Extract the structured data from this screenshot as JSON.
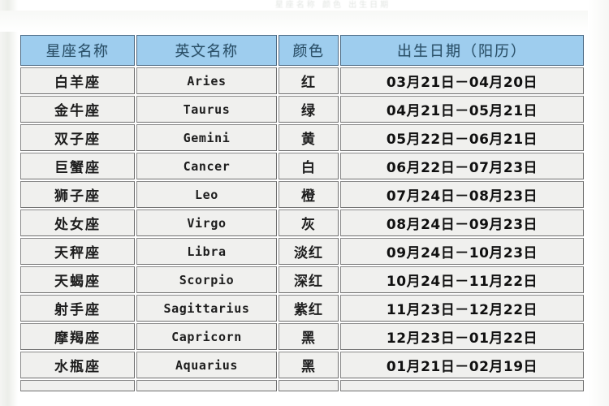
{
  "page": {
    "scan_remnant_text": "星座名称   颜色   出生日期",
    "background_color": "#ffffff"
  },
  "table": {
    "header_background": "#9ecdee",
    "header_text_color": "#2b4f66",
    "cell_background": "#f0f0ee",
    "border_color": "#6f6f6f",
    "columns": [
      {
        "key": "name",
        "label": "星座名称"
      },
      {
        "key": "en",
        "label": "英文名称"
      },
      {
        "key": "color",
        "label": "颜色"
      },
      {
        "key": "date",
        "label": "出生日期（阳历）"
      }
    ],
    "rows": [
      {
        "name": "白羊座",
        "en": "Aries",
        "color": "红",
        "date": "03月21日－04月20日"
      },
      {
        "name": "金牛座",
        "en": "Taurus",
        "color": "绿",
        "date": "04月21日－05月21日"
      },
      {
        "name": "双子座",
        "en": "Gemini",
        "color": "黄",
        "date": "05月22日－06月21日"
      },
      {
        "name": "巨蟹座",
        "en": "Cancer",
        "color": "白",
        "date": "06月22日－07月23日"
      },
      {
        "name": "狮子座",
        "en": "Leo",
        "color": "橙",
        "date": "07月24日－08月23日"
      },
      {
        "name": "处女座",
        "en": "Virgo",
        "color": "灰",
        "date": "08月24日－09月23日"
      },
      {
        "name": "天秤座",
        "en": "Libra",
        "color": "淡红",
        "date": "09月24日－10月23日"
      },
      {
        "name": "天蝎座",
        "en": "Scorpio",
        "color": "深红",
        "date": "10月24日－11月22日"
      },
      {
        "name": "射手座",
        "en": "Sagittarius",
        "color": "紫红",
        "date": "11月23日－12月22日"
      },
      {
        "name": "摩羯座",
        "en": "Capricorn",
        "color": "黑",
        "date": "12月23日－01月22日"
      },
      {
        "name": "水瓶座",
        "en": "Aquarius",
        "color": "黑",
        "date": "01月21日－02月19日"
      }
    ]
  }
}
